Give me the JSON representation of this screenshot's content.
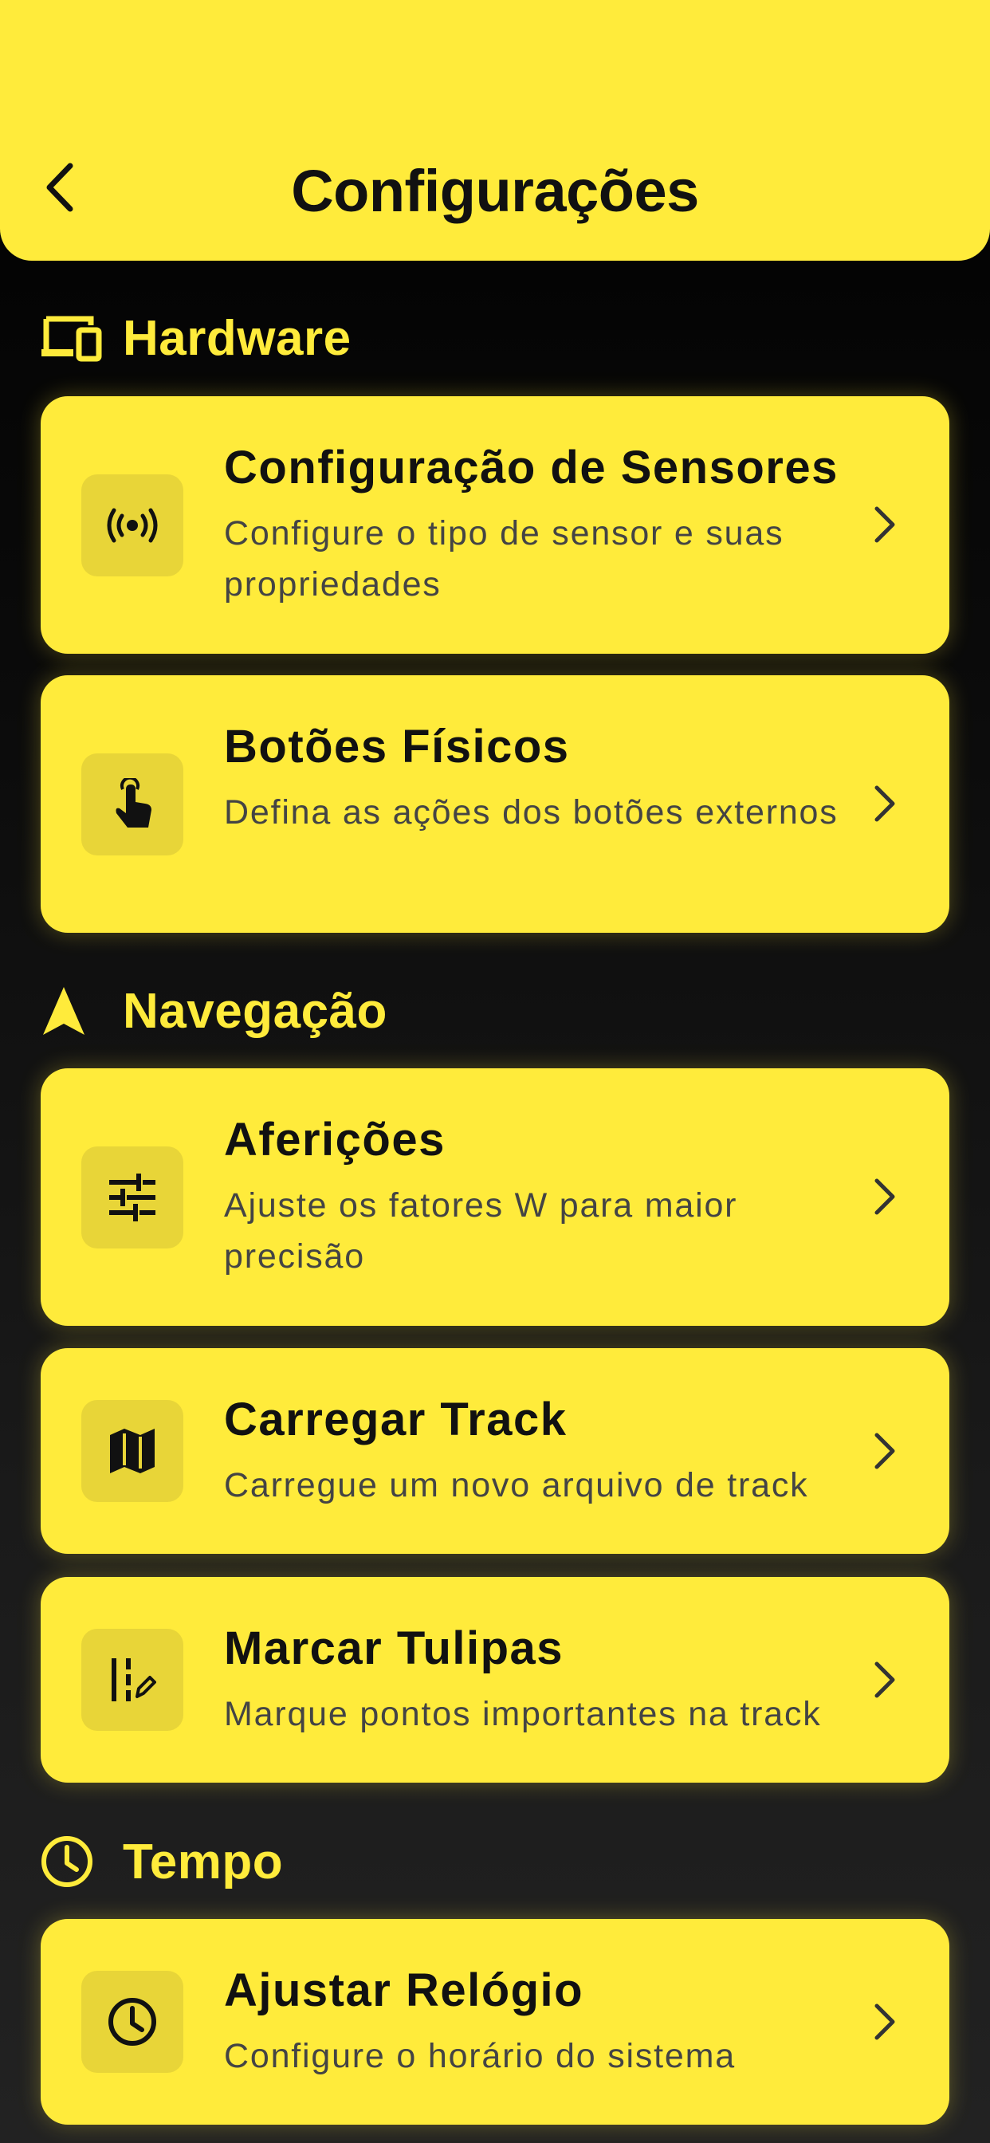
{
  "header": {
    "title": "Configurações",
    "back_icon": "chevron-left-icon",
    "background": "#FFEB3B"
  },
  "sections": [
    {
      "title": "Hardware",
      "icon": "devices-icon",
      "items": [
        {
          "title": "Configuração de Sensores",
          "description": "Configure o tipo de sensor e suas propriedades",
          "icon": "sensors-icon"
        },
        {
          "title": "Botões Físicos",
          "description": "Defina as ações dos botões externos",
          "icon": "touch-icon"
        }
      ]
    },
    {
      "title": "Navegação",
      "icon": "navigation-arrow-icon",
      "items": [
        {
          "title": "Aferições",
          "description": "Ajuste os fatores W para maior precisão",
          "icon": "tune-icon"
        },
        {
          "title": "Carregar Track",
          "description": "Carregue um novo arquivo de track",
          "icon": "map-icon"
        },
        {
          "title": "Marcar Tulipas",
          "description": "Marque pontos importantes na track",
          "icon": "edit-marks-icon"
        }
      ]
    },
    {
      "title": "Tempo",
      "icon": "clock-icon",
      "items": [
        {
          "title": "Ajustar Relógio",
          "description": "Configure o horário do sistema",
          "icon": "clock-icon"
        }
      ]
    }
  ],
  "colors": {
    "accent": "#FFEB3B",
    "icon_box": "#E8D538",
    "text_dark": "#111111",
    "text_muted": "#444444"
  }
}
